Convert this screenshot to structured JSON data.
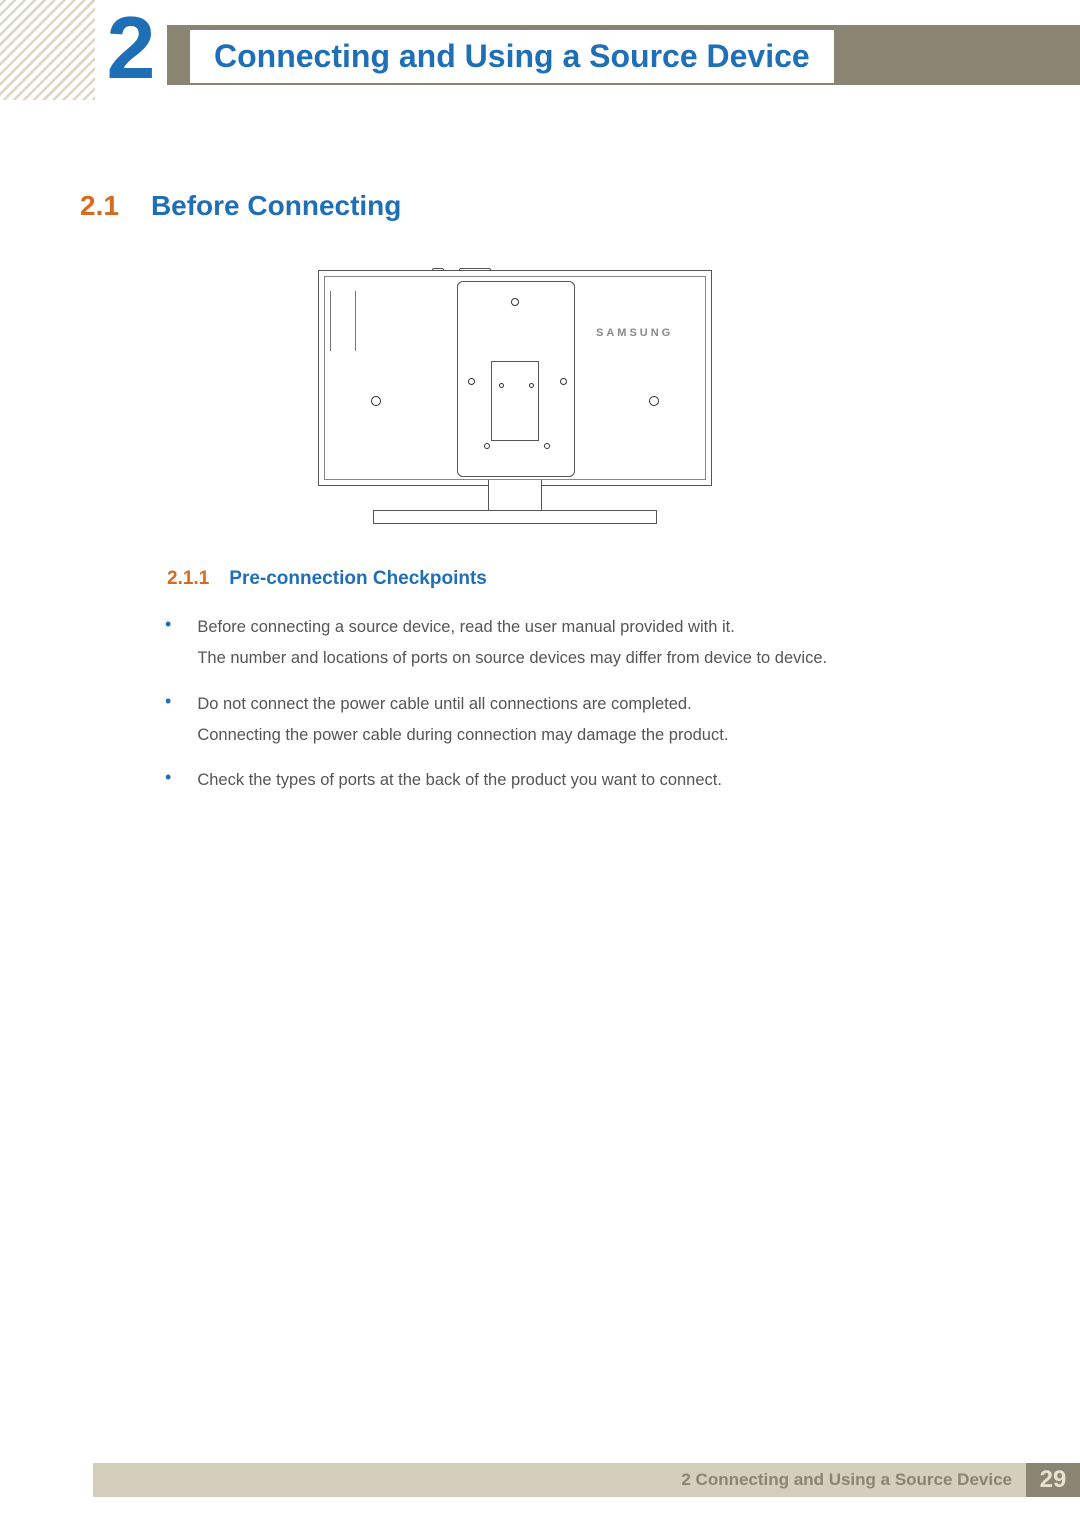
{
  "chapter": {
    "number": "2",
    "title": "Connecting and Using a Source Device"
  },
  "section": {
    "number": "2.1",
    "title": "Before Connecting"
  },
  "illustration": {
    "brand": "SAMSUNG"
  },
  "subsection": {
    "number": "2.1.1",
    "title": "Pre-connection Checkpoints"
  },
  "bullets": [
    {
      "line1": "Before connecting a source device, read the user manual provided with it.",
      "line2": "The number and locations of ports on source devices may differ from device to device."
    },
    {
      "line1": "Do not connect the power cable until all connections are completed.",
      "line2": "Connecting the power cable during connection may damage the product."
    },
    {
      "line1": "Check the types of ports at the back of the product you want to connect.",
      "line2": ""
    }
  ],
  "footer": {
    "text": "2 Connecting and Using a Source Device",
    "page": "29"
  }
}
